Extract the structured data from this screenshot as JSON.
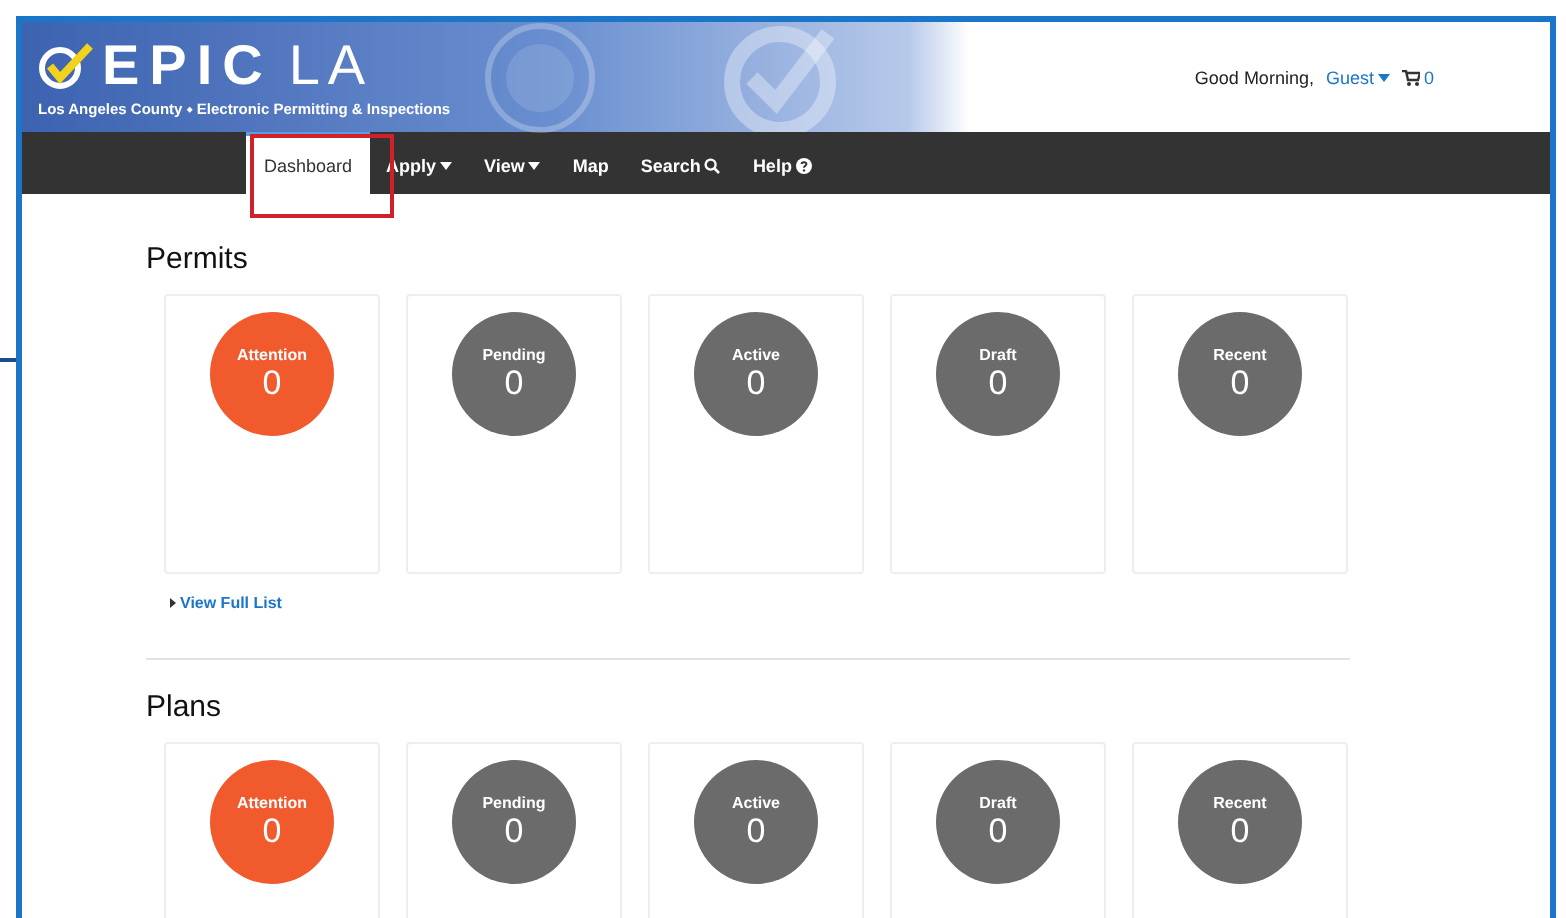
{
  "header": {
    "logo_bold": "EPIC",
    "logo_light": "LA",
    "subtitle": "Los Angeles County ⬩ Electronic Permitting & Inspections",
    "greeting": "Good Morning,",
    "user": "Guest",
    "cart_count": "0"
  },
  "nav": [
    {
      "label": "Dashboard",
      "selected": true,
      "kind": "plain"
    },
    {
      "label": "Apply",
      "selected": false,
      "kind": "dropdown"
    },
    {
      "label": "View",
      "selected": false,
      "kind": "dropdown"
    },
    {
      "label": "Map",
      "selected": false,
      "kind": "plain"
    },
    {
      "label": "Search",
      "selected": false,
      "kind": "search"
    },
    {
      "label": "Help",
      "selected": false,
      "kind": "help"
    }
  ],
  "sections": [
    {
      "title": "Permits",
      "link": "View Full List",
      "cards": [
        {
          "label": "Attention",
          "count": "0",
          "color": "#f05a2d"
        },
        {
          "label": "Pending",
          "count": "0",
          "color": "#6b6b6b"
        },
        {
          "label": "Active",
          "count": "0",
          "color": "#6b6b6b"
        },
        {
          "label": "Draft",
          "count": "0",
          "color": "#6b6b6b"
        },
        {
          "label": "Recent",
          "count": "0",
          "color": "#6b6b6b"
        }
      ]
    },
    {
      "title": "Plans",
      "cards": [
        {
          "label": "Attention",
          "count": "0",
          "color": "#f05a2d"
        },
        {
          "label": "Pending",
          "count": "0",
          "color": "#6b6b6b"
        },
        {
          "label": "Active",
          "count": "0",
          "color": "#6b6b6b"
        },
        {
          "label": "Draft",
          "count": "0",
          "color": "#6b6b6b"
        },
        {
          "label": "Recent",
          "count": "0",
          "color": "#6b6b6b"
        }
      ]
    }
  ]
}
